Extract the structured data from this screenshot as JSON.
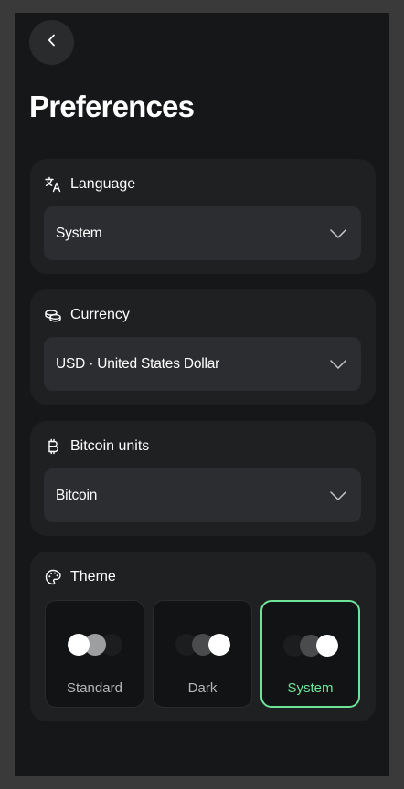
{
  "header": {
    "back_icon": "chevron-left-icon",
    "title": "Preferences"
  },
  "language": {
    "icon": "translate-icon",
    "label": "Language",
    "value": "System"
  },
  "currency": {
    "icon": "coins-icon",
    "label": "Currency",
    "value": "USD · United States Dollar"
  },
  "bitcoin_units": {
    "icon": "bitcoin-icon",
    "label": "Bitcoin units",
    "value": "Bitcoin"
  },
  "theme": {
    "icon": "palette-icon",
    "label": "Theme",
    "selected": "System",
    "options": [
      {
        "label": "Standard"
      },
      {
        "label": "Dark"
      },
      {
        "label": "System"
      }
    ]
  },
  "colors": {
    "background": "#161718",
    "card": "#1f2022",
    "select": "#2c2d30",
    "accent": "#6fe39a",
    "text": "#ffffff",
    "muted_text": "#b5b6b8"
  }
}
